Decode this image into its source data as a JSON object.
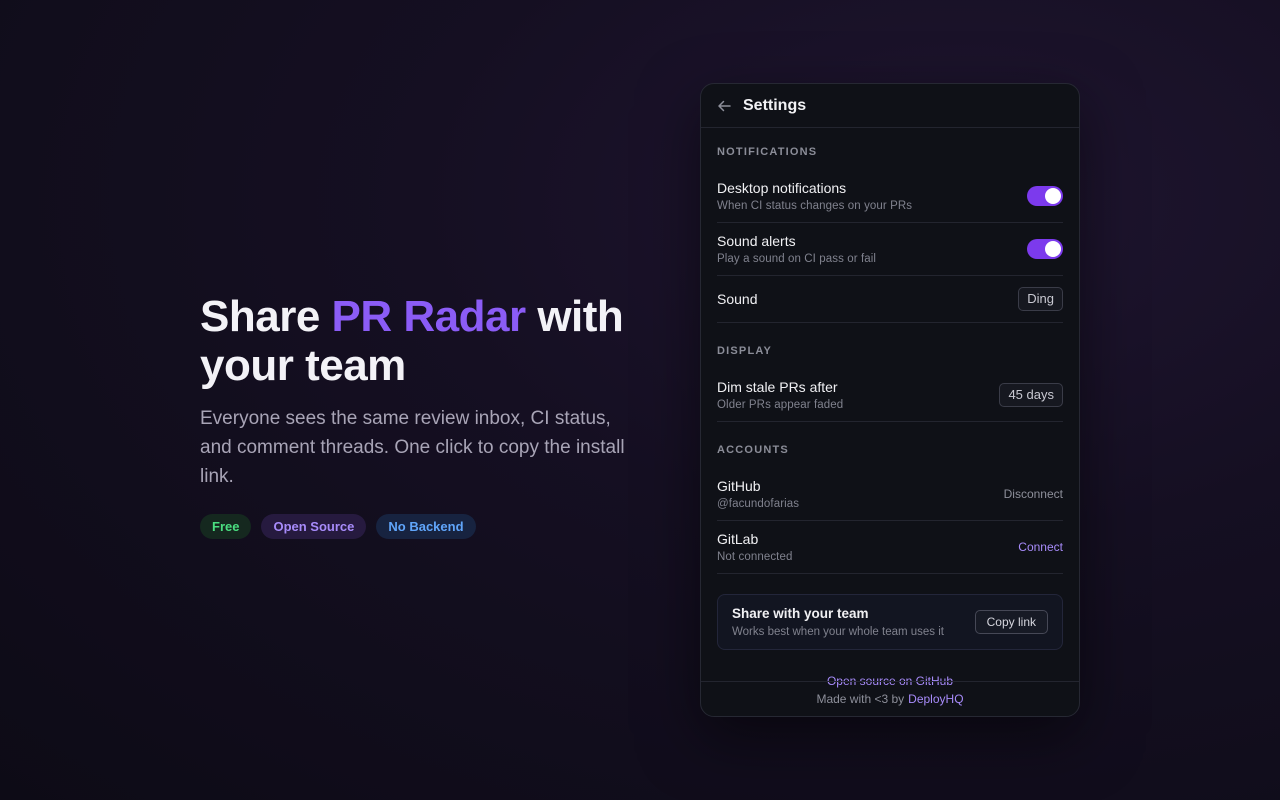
{
  "hero": {
    "title_part1": "Share ",
    "title_accent": "PR Radar",
    "title_part2": " with your team",
    "description": "Everyone sees the same review inbox, CI status, and comment threads. One click to copy the install link.",
    "badges": [
      "Free",
      "Open Source",
      "No Backend"
    ]
  },
  "panel": {
    "back_icon": "arrow-left-icon",
    "title": "Settings",
    "notifications": {
      "label": "NOTIFICATIONS",
      "desktop": {
        "title": "Desktop notifications",
        "subtitle": "When CI status changes on your PRs",
        "enabled": true
      },
      "sound_alerts": {
        "title": "Sound alerts",
        "subtitle": "Play a sound on CI pass or fail",
        "enabled": true
      },
      "sound": {
        "title": "Sound",
        "value": "Ding"
      }
    },
    "display": {
      "label": "DISPLAY",
      "dim": {
        "title": "Dim stale PRs after",
        "subtitle": "Older PRs appear faded",
        "value": "45 days"
      }
    },
    "accounts": {
      "label": "ACCOUNTS",
      "github": {
        "title": "GitHub",
        "subtitle": "@facundofarias",
        "action": "Disconnect"
      },
      "gitlab": {
        "title": "GitLab",
        "subtitle": "Not connected",
        "action": "Connect"
      }
    },
    "share": {
      "title": "Share with your team",
      "subtitle": "Works best when your whole team uses it",
      "button": "Copy link"
    },
    "github_link": "Open source on GitHub",
    "footer": {
      "text": "Made with <3 by",
      "brand": "DeployHQ"
    }
  },
  "colors": {
    "accent": "#8b5cf6",
    "toggle_on": "#7c3aed",
    "badge_free": "#4ade80",
    "badge_open_source": "#a78bfa",
    "badge_no_backend": "#60a5fa"
  }
}
